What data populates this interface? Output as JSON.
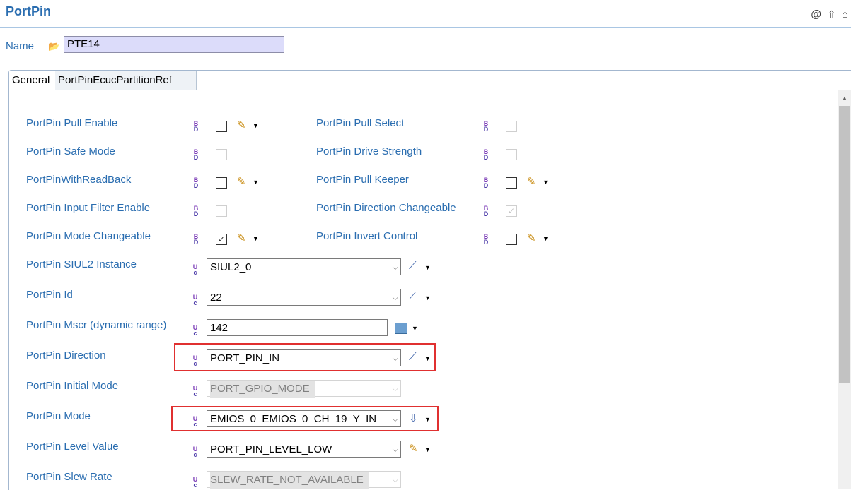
{
  "header": {
    "title": "PortPin",
    "icons": [
      "at-icon",
      "up-arrow-icon",
      "home-icon"
    ]
  },
  "name_field": {
    "label": "Name",
    "value": "PTE14"
  },
  "tabs": [
    {
      "label": "General"
    },
    {
      "label": "PortPinEcucPartitionRef"
    }
  ],
  "checkbox_params": {
    "left": [
      {
        "label": "PortPin Pull Enable",
        "checked": false,
        "enabled": true
      },
      {
        "label": "PortPin Safe Mode",
        "checked": false,
        "enabled": false
      },
      {
        "label": "PortPinWithReadBack",
        "checked": false,
        "enabled": true
      },
      {
        "label": "PortPin Input Filter Enable",
        "checked": false,
        "enabled": false
      },
      {
        "label": "PortPin Mode Changeable",
        "checked": true,
        "enabled": true
      }
    ],
    "right": [
      {
        "label": "PortPin Pull Select",
        "checked": false,
        "enabled": false
      },
      {
        "label": "PortPin Drive Strength",
        "checked": false,
        "enabled": false
      },
      {
        "label": "PortPin Pull Keeper",
        "checked": false,
        "enabled": true
      },
      {
        "label": "PortPin Direction Changeable",
        "checked": true,
        "enabled": false
      },
      {
        "label": "PortPin Invert Control",
        "checked": false,
        "enabled": true
      }
    ]
  },
  "combo_params": [
    {
      "label": "PortPin SIUL2 Instance",
      "value": "SIUL2_0",
      "enabled": true
    },
    {
      "label": "PortPin Id",
      "value": "22",
      "enabled": true
    },
    {
      "label": "PortPin Mscr (dynamic range)",
      "value": "142",
      "enabled": true
    },
    {
      "label": "PortPin Direction",
      "value": "PORT_PIN_IN",
      "enabled": true
    },
    {
      "label": "PortPin Initial Mode",
      "value": "PORT_GPIO_MODE",
      "enabled": false
    },
    {
      "label": "PortPin Mode",
      "value": "EMIOS_0_EMIOS_0_CH_19_Y_IN",
      "enabled": true
    },
    {
      "label": "PortPin Level Value",
      "value": "PORT_PIN_LEVEL_LOW",
      "enabled": true
    },
    {
      "label": "PortPin Slew Rate",
      "value": "SLEW_RATE_NOT_AVAILABLE",
      "enabled": false
    }
  ],
  "icon_glyphs": {
    "param_top": "B",
    "param_bottom": "D",
    "combo_top": "U",
    "combo_bottom": "c"
  },
  "colors": {
    "label": "#2a6db0",
    "highlight": "#e03030",
    "name_bg": "#dcdcfa"
  }
}
